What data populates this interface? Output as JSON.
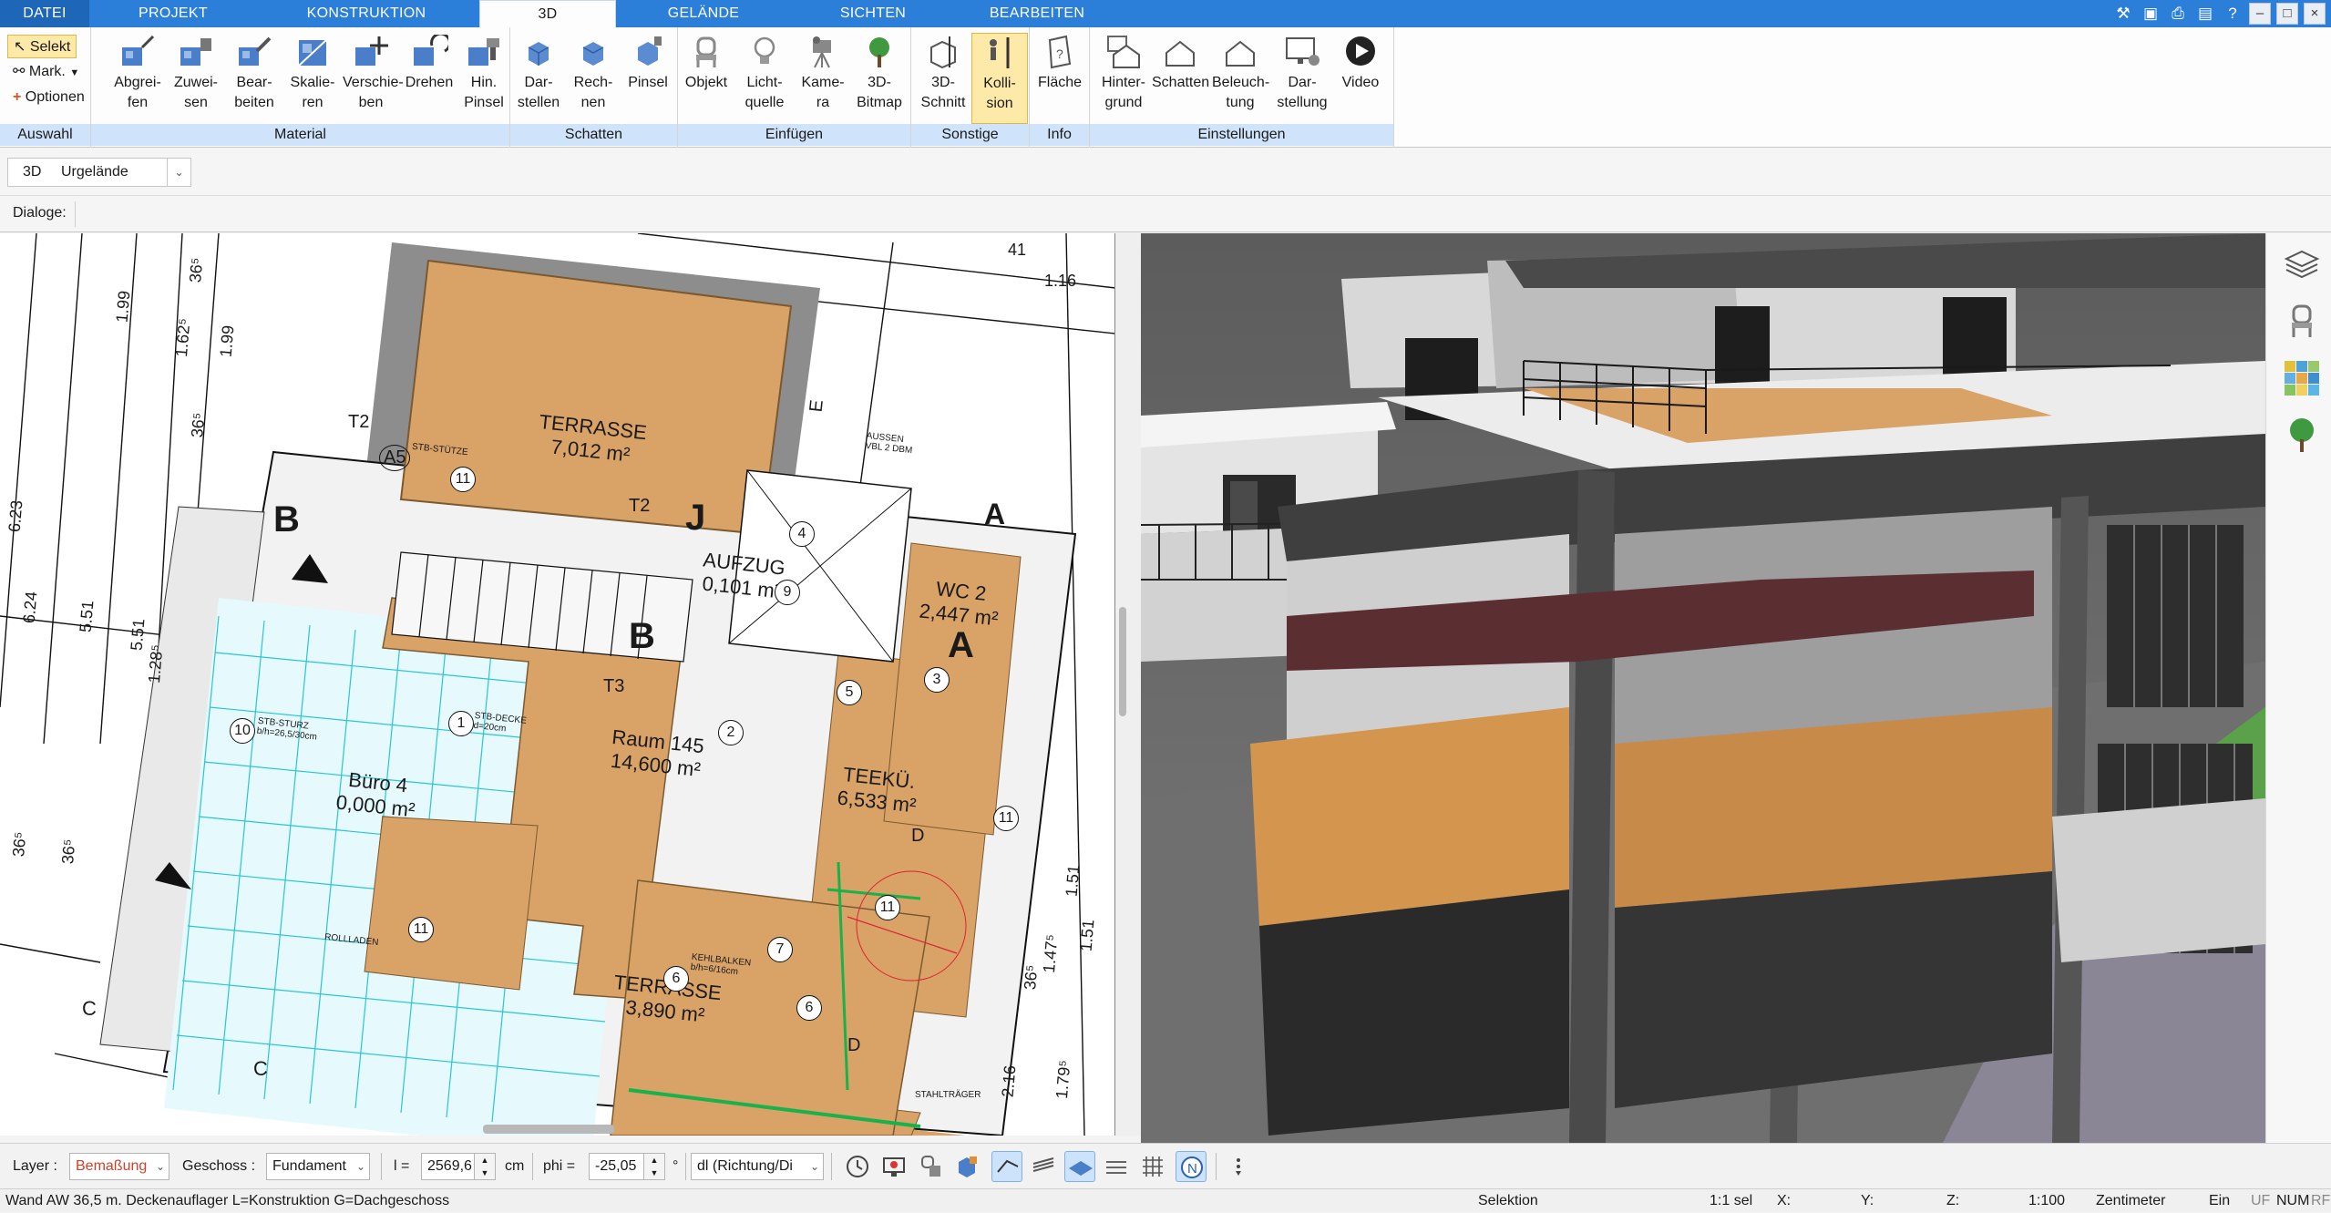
{
  "tabs": [
    "DATEI",
    "PROJEKT",
    "KONSTRUKTION",
    "3D",
    "GELÄNDE",
    "SICHTEN",
    "BEARBEITEN"
  ],
  "active_tab": "3D",
  "window_buttons": [
    "–",
    "□",
    "×"
  ],
  "ribbon": {
    "auswahl": {
      "label": "Auswahl",
      "selekt": "Selekt",
      "mark": "Mark.",
      "optionen": "Optionen"
    },
    "material": {
      "label": "Material",
      "buttons": [
        "Abgrei-\nfen",
        "Zuwei-\nsen",
        "Bear-\nbeiten",
        "Skalie-\nren",
        "Verschie-\nben",
        "Drehen",
        "Hin.\nPinsel"
      ]
    },
    "schatten": {
      "label": "Schatten",
      "buttons": [
        "Dar-\nstellen",
        "Rech-\nnen",
        "Pinsel"
      ]
    },
    "einfuegen": {
      "label": "Einfügen",
      "buttons": [
        "Objekt",
        "Licht-\nquelle",
        "Kame-\nra",
        "3D-\nBitmap"
      ]
    },
    "sonstige": {
      "label": "Sonstige",
      "buttons": [
        "3D-\nSchnitt",
        "Kolli-\nsion"
      ]
    },
    "info": {
      "label": "Info",
      "buttons": [
        "Fläche"
      ]
    },
    "einstellungen": {
      "label": "Einstellungen",
      "buttons": [
        "Hinter-\ngrund",
        "Schatten",
        "Beleuch-\ntung",
        "Dar-\nstellung",
        "Video"
      ]
    }
  },
  "toolbar2": {
    "mode": "3D",
    "terrain_select": "Urgelände"
  },
  "toolbar3": {
    "dialoge_label": "Dialoge:"
  },
  "plan": {
    "rooms": [
      {
        "name": "TERRASSE",
        "area": "7,012 m²"
      },
      {
        "name": "AUFZUG",
        "area": "0,101 m²"
      },
      {
        "name": "WC 2",
        "area": "2,447 m²"
      },
      {
        "name": "Raum 145",
        "area": "14,600 m²"
      },
      {
        "name": "Büro 4",
        "area": "0,000 m²"
      },
      {
        "name": "TEEKÜ.",
        "area": "6,533 m²"
      },
      {
        "name": "TERRASSE",
        "area": "3,890 m²"
      }
    ],
    "section_marks": [
      "B",
      "B",
      "J",
      "A",
      "A",
      "C",
      "C",
      "E",
      "D",
      "D",
      "T2",
      "T2",
      "T3",
      "A5"
    ],
    "dimensions": [
      "1.99",
      "1.62⁵",
      "1.99",
      "36⁵",
      "36⁵",
      "6.23",
      "6.24",
      "5.51",
      "5.51",
      "1.28⁵",
      "36⁵",
      "36⁵",
      "41",
      "1.16",
      "1.51",
      "1.51",
      "2.16",
      "1.79⁵",
      "36⁵",
      "1.47⁵"
    ],
    "circles": [
      "11",
      "1",
      "2",
      "3",
      "4",
      "5",
      "6",
      "6",
      "7",
      "9",
      "10",
      "11",
      "11",
      "11"
    ],
    "notes": [
      "STB-STÜTZE",
      "STB-STURZ b/h=26,5/30cm",
      "STB-DECKE d=20cm",
      "KEHLBALKEN b/h=6/16cm",
      "STAHLTRÄGER",
      "ROLLLADEN",
      "AUSSEN VBL 2 DBM"
    ]
  },
  "right_tools": [
    "layers-icon",
    "chair-icon",
    "palette-icon",
    "tree-icon"
  ],
  "bottom": {
    "layer_label": "Layer :",
    "layer_value": "Bemaßung",
    "geschoss_label": "Geschoss :",
    "geschoss_value": "Fundament",
    "l_label": "l =",
    "l_value": "2569,6",
    "l_unit": "cm",
    "phi_label": "phi =",
    "phi_value": "-25,05",
    "phi_unit": "°",
    "dl_value": "dl (Richtung/Di"
  },
  "status": {
    "message": "Wand AW 36,5 m. Deckenauflager L=Konstruktion G=Dachgeschoss",
    "mode": "Selektion",
    "sel": "1:1 sel",
    "x": "X:",
    "y": "Y:",
    "z": "Z:",
    "scale": "1:100",
    "unit": "Zentimeter",
    "ein": "Ein",
    "uf": "UF",
    "num": "NUM",
    "rf": "RF"
  },
  "colors": {
    "tab_blue": "#2b7fd8",
    "group_footer": "#cfe3fa",
    "active_button": "#fde9a8",
    "wood": "#d9a267"
  }
}
